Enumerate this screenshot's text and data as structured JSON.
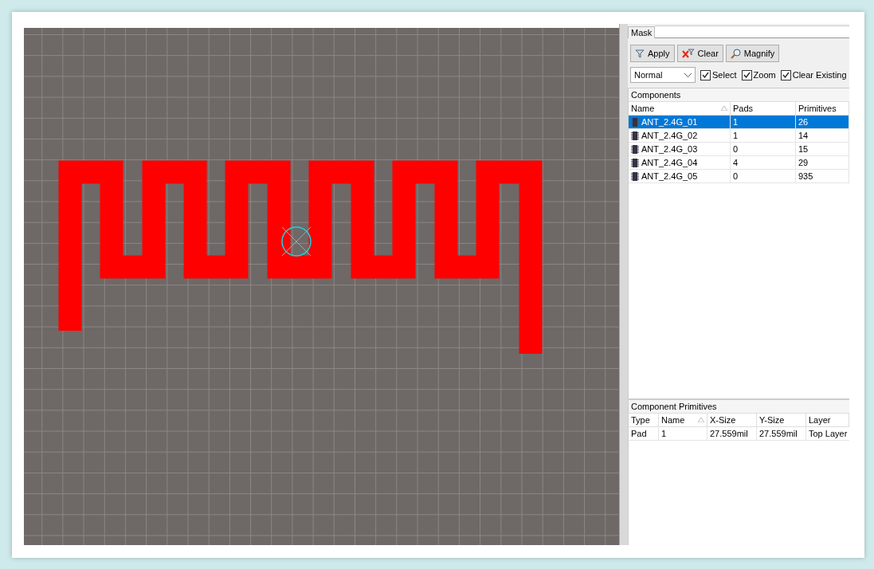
{
  "mask": {
    "label": "Mask"
  },
  "buttons": [
    {
      "kind": "filter",
      "label": "Apply"
    },
    {
      "kind": "clear",
      "label": "Clear"
    },
    {
      "kind": "magnify",
      "label": "Magnify"
    }
  ],
  "mode": {
    "value": "Normal"
  },
  "options": [
    {
      "label": "Select",
      "checked": true
    },
    {
      "label": "Zoom",
      "checked": true
    },
    {
      "label": "Clear Existing",
      "checked": true
    }
  ],
  "components": {
    "title": "Components",
    "columns": [
      "Name",
      "Pads",
      "Primitives"
    ],
    "rows": [
      {
        "name": "ANT_2.4G_01",
        "pads": "1",
        "primitives": "26",
        "selected": true
      },
      {
        "name": "ANT_2.4G_02",
        "pads": "1",
        "primitives": "14",
        "selected": false
      },
      {
        "name": "ANT_2.4G_03",
        "pads": "0",
        "primitives": "15",
        "selected": false
      },
      {
        "name": "ANT_2.4G_04",
        "pads": "4",
        "primitives": "29",
        "selected": false
      },
      {
        "name": "ANT_2.4G_05",
        "pads": "0",
        "primitives": "935",
        "selected": false
      }
    ]
  },
  "primitives": {
    "title": "Component Primitives",
    "columns": [
      "Type",
      "Name",
      "X-Size",
      "Y-Size",
      "Layer"
    ],
    "rows": [
      [
        "Pad",
        "1",
        "27.559mil",
        "27.559mil",
        "Top Layer"
      ]
    ]
  }
}
